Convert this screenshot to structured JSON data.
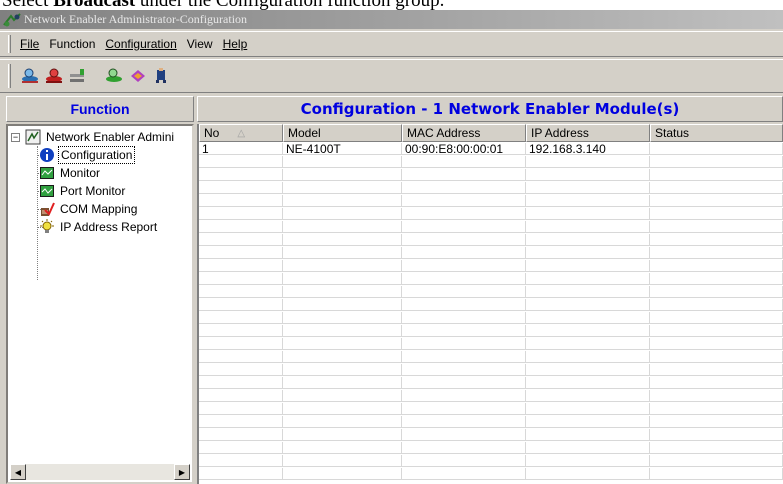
{
  "caption": {
    "before": "Select ",
    "bold": "Broadcast",
    "after": " under the Configuration function group."
  },
  "window": {
    "title": "Network Enabler Administrator-Configuration"
  },
  "menu": [
    {
      "label": "File"
    },
    {
      "label": "Function"
    },
    {
      "label": "Configuration"
    },
    {
      "label": "View"
    },
    {
      "label": "Help"
    }
  ],
  "toolbar": {
    "buttons": [
      "search-server-icon",
      "broadcast-icon",
      "settings-icon",
      "monitor-icon",
      "disk-icon",
      "user-icon"
    ]
  },
  "function_panel": {
    "header": "Function",
    "tree": {
      "root": "Network Enabler Admini",
      "items": [
        {
          "label": "Configuration",
          "icon": "info-icon"
        },
        {
          "label": "Monitor",
          "icon": "monitor-icon"
        },
        {
          "label": "Port Monitor",
          "icon": "port-monitor-icon"
        },
        {
          "label": "COM Mapping",
          "icon": "com-mapping-icon"
        },
        {
          "label": "IP Address Report",
          "icon": "ip-report-icon"
        }
      ]
    }
  },
  "config_panel": {
    "header": "Configuration - 1 Network Enabler Module(s)",
    "columns": [
      "No",
      "Model",
      "MAC Address",
      "IP Address",
      "Status"
    ],
    "sort_indicator": "△",
    "rows": [
      {
        "no": "1",
        "model": "NE-4100T",
        "mac": "00:90:E8:00:00:01",
        "ip": "192.168.3.140",
        "status": ""
      }
    ]
  }
}
